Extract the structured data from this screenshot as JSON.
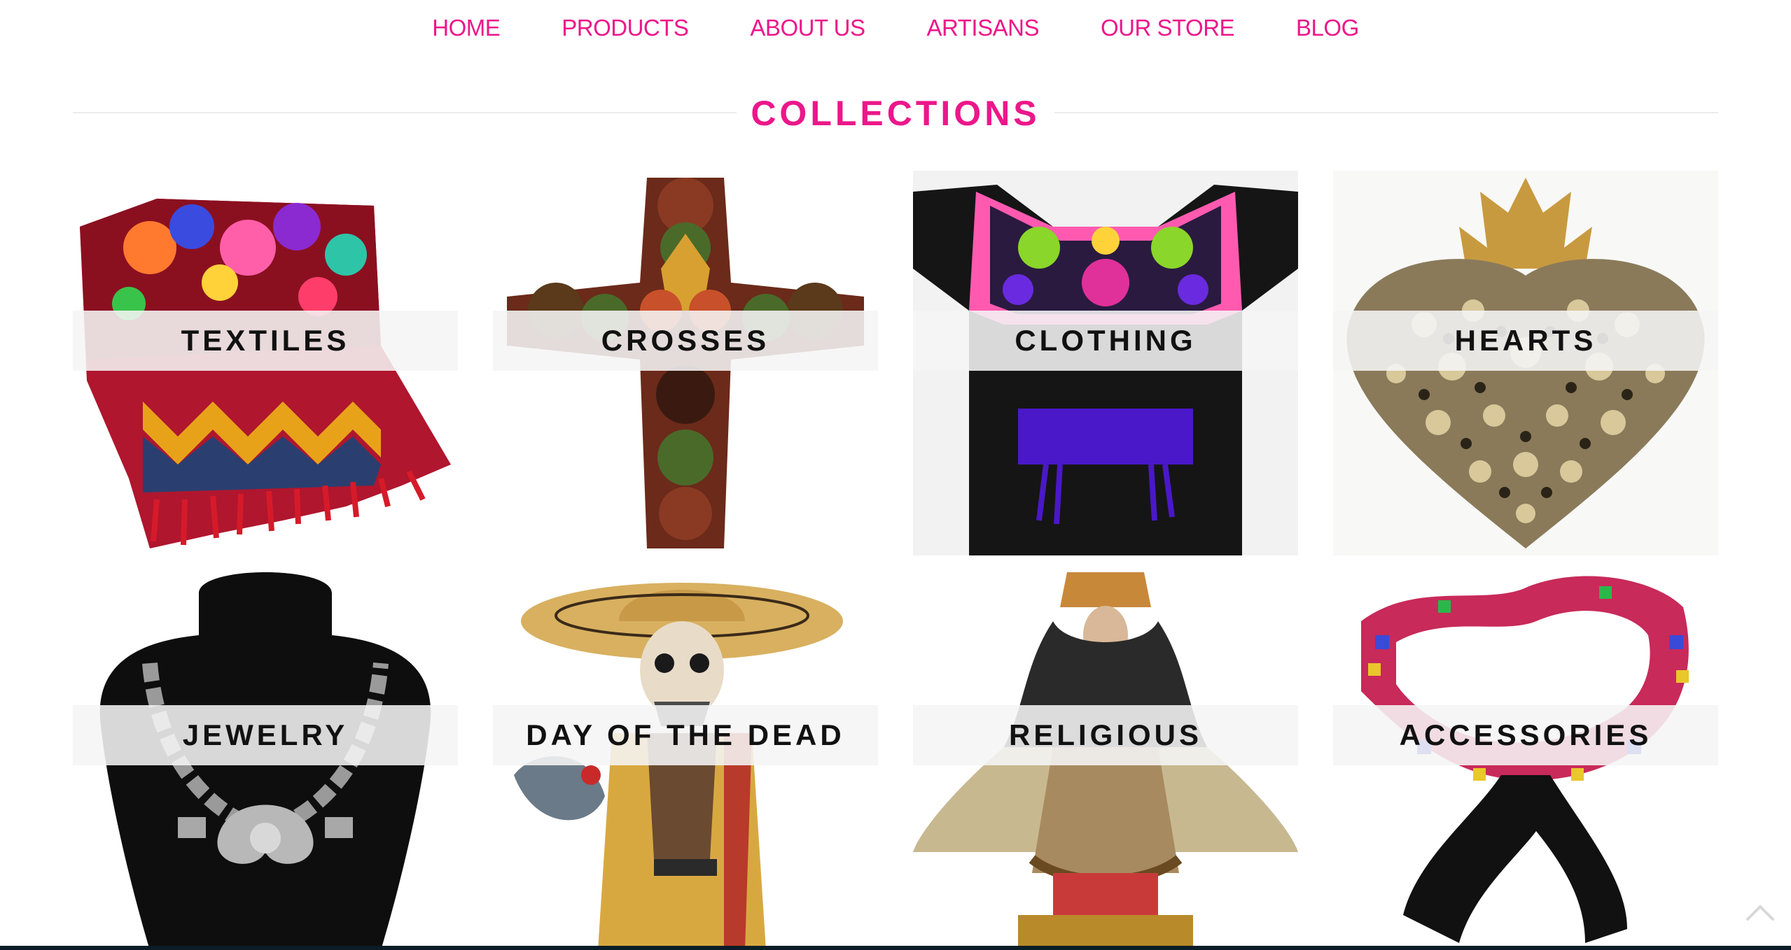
{
  "nav": {
    "items": [
      {
        "label": "HOME"
      },
      {
        "label": "PRODUCTS"
      },
      {
        "label": "ABOUT US"
      },
      {
        "label": "ARTISANS"
      },
      {
        "label": "OUR STORE"
      },
      {
        "label": "BLOG"
      }
    ]
  },
  "section": {
    "title": "COLLECTIONS"
  },
  "collections": [
    {
      "label": "TEXTILES",
      "icon": "folded-textile-image"
    },
    {
      "label": "CROSSES",
      "icon": "carved-cross-image"
    },
    {
      "label": "CLOTHING",
      "icon": "embroidered-dress-image"
    },
    {
      "label": "HEARTS",
      "icon": "milagro-heart-image"
    },
    {
      "label": "JEWELRY",
      "icon": "silver-necklace-image"
    },
    {
      "label": "DAY OF THE DEAD",
      "icon": "catrina-figure-image"
    },
    {
      "label": "RELIGIOUS",
      "icon": "virgin-statue-image"
    },
    {
      "label": "ACCESSORIES",
      "icon": "woven-belt-image"
    }
  ],
  "colors": {
    "accent": "#ec178a",
    "label_text": "#111111",
    "rule": "#ececec"
  }
}
